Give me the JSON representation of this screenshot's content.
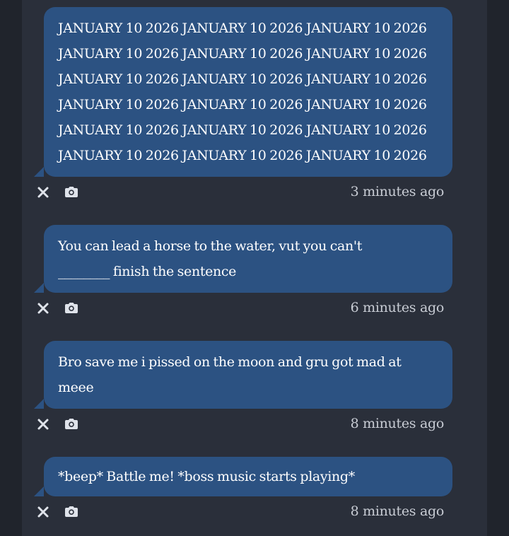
{
  "messages": [
    {
      "text": "JANUARY 10 2026 JANUARY 10 2026 JANUARY 10 2026\nJANUARY 10 2026 JANUARY 10 2026 JANUARY 10 2026\nJANUARY 10 2026 JANUARY 10 2026 JANUARY 10 2026\nJANUARY 10 2026 JANUARY 10 2026 JANUARY 10 2026\nJANUARY 10 2026 JANUARY 10 2026 JANUARY 10 2026\nJANUARY 10 2026 JANUARY 10 2026 JANUARY 10 2026",
      "time": "3 minutes ago"
    },
    {
      "text": "You can lead a horse to the water, vut you can't\n________ finish the sentence",
      "time": "6 minutes ago"
    },
    {
      "text": "Bro save me i pissed on the moon and gru got mad at\nmeee",
      "time": "8 minutes ago"
    },
    {
      "text": "*beep* Battle me! *boss music starts playing*",
      "time": "8 minutes ago"
    }
  ],
  "icons": {
    "dismiss": "close-icon",
    "screenshot": "camera-icon"
  },
  "colors": {
    "page_background": "#20242c",
    "panel_background": "#2a2f3a",
    "bubble_background": "#2c5282",
    "bubble_text": "#ffffff",
    "timestamp_text": "#c8ccd4",
    "icon_color": "#dfe3ea"
  }
}
